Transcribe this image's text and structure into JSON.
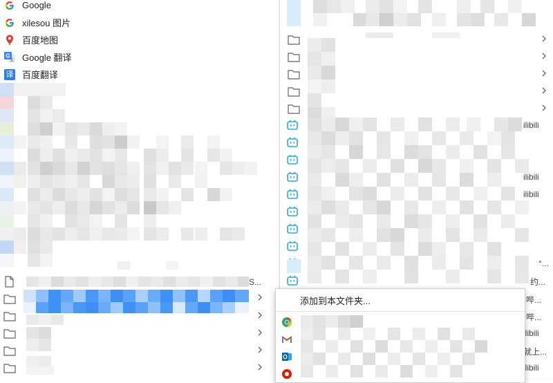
{
  "bookmarks_top": [
    {
      "label": "Google",
      "icon": "google-icon"
    },
    {
      "label": "xilesou 图片",
      "icon": "google-icon"
    },
    {
      "label": "百度地图",
      "icon": "map-pin-icon"
    },
    {
      "label": "Google 翻译",
      "icon": "google-translate-icon"
    },
    {
      "label": "百度翻译",
      "icon": "baidu-translate-icon"
    }
  ],
  "baidu_translate_glyph": "译",
  "context_menu": {
    "add_label": "添加到本文件夹..."
  },
  "right_fragments": [
    "ilibili",
    "ilibili",
    "ilibili",
    "°...",
    "约...",
    "哔...",
    "哔...",
    "ilibili",
    "就上...",
    "ilibili"
  ],
  "left_fragment": "S...",
  "colors": {
    "accent_blue": "#1a73e8",
    "bilibili_cyan": "#23ade5",
    "selection_blue": "#3d8ff5"
  }
}
